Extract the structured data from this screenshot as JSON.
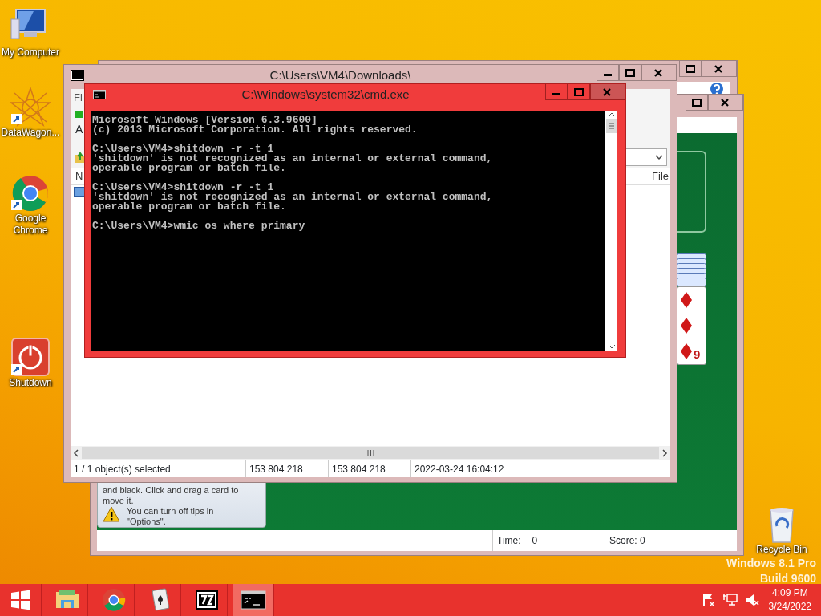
{
  "desktop_icons": [
    {
      "label": "My Computer",
      "kind": "computer"
    },
    {
      "label": "DataWagon...",
      "kind": "star"
    },
    {
      "label": "Google Chrome",
      "kind": "chrome"
    },
    {
      "label": "Shutdown",
      "kind": "power"
    },
    {
      "label": "Recycle Bin",
      "kind": "bin"
    }
  ],
  "os_watermark": [
    "Windows 8.1 Pro",
    "Build 9600"
  ],
  "solitaire_window": {
    "tip_text": "and black. Click and drag a card to move it.",
    "tip_note": "You can turn off tips in \"Options\".",
    "card_rank": "9",
    "time_label": "Time:",
    "time": "0",
    "score": "Score: 0"
  },
  "archive_window": {
    "title": "C:\\Users\\VM4\\Downloads\\",
    "menu_fragment": "Fi",
    "toolbar_fragment": "A",
    "column_name": "N",
    "column_file": "File",
    "status": [
      "1 / 1 object(s) selected",
      "153 804 218",
      "153 804 218",
      "2022-03-24 16:04:12"
    ]
  },
  "console_window": {
    "title": "C:\\Windows\\system32\\cmd.exe",
    "paragraphs": [
      [
        "Microsoft Windows [Version 6.3.9600]",
        "(c) 2013 Microsoft Corporation. All rights reserved."
      ],
      [
        "C:\\Users\\VM4>shitdown -r -t 1",
        "'shitdown' is not recognized as an internal or external command,",
        "operable program or batch file."
      ],
      [
        "C:\\Users\\VM4>shitdown -r -t 1",
        "'shitdown' is not recognized as an internal or external command,",
        "operable program or batch file."
      ],
      [
        "C:\\Users\\VM4>wmic os where primary"
      ]
    ]
  },
  "taskbar": {
    "items": [
      {
        "kind": "explorer",
        "selected": false
      },
      {
        "kind": "chrome",
        "selected": false
      },
      {
        "kind": "solitaire",
        "selected": false
      },
      {
        "kind": "archiver",
        "selected": false
      },
      {
        "kind": "console",
        "selected": true
      }
    ],
    "clock_time": "4:09 PM",
    "clock_date": "3/24/2022"
  }
}
